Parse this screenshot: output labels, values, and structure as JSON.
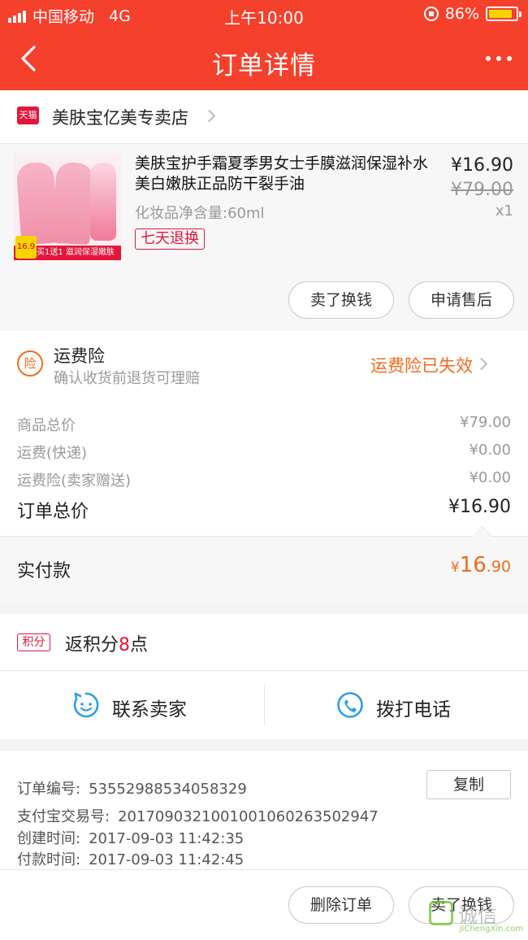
{
  "status_bar": {
    "carrier": "中国移动",
    "network": "4G",
    "time": "上午10:00",
    "battery": "86%",
    "battery_level": 0.86
  },
  "nav": {
    "title": "订单详情"
  },
  "store": {
    "badge": "天猫",
    "name": "美肤宝亿美专卖店"
  },
  "product": {
    "title": "美肤宝护手霜夏季男女士手膜滋润保湿补水美白嫩肤正品防干裂手油",
    "spec": "化妆品净含量:60ml",
    "tag": "七天退换",
    "price": "¥16.90",
    "original_price": "¥79.00",
    "quantity": "x1",
    "thumb_banner": "买1送1 滋润保湿嫩肤",
    "thumb_price": "16.9",
    "buttons": {
      "sell": "卖了换钱",
      "after_sale": "申请售后"
    }
  },
  "insurance": {
    "icon_text": "险",
    "title": "运费险",
    "subtitle": "确认收货前退货可理赔",
    "status": "运费险已失效"
  },
  "summary": {
    "rows": [
      {
        "label": "商品总价",
        "value": "¥79.00"
      },
      {
        "label": "运费(快递)",
        "value": "¥0.00"
      },
      {
        "label": "运费险(卖家赠送)",
        "value": "¥0.00"
      }
    ],
    "total_label": "订单总价",
    "total_value": "¥16.90"
  },
  "payment": {
    "label": "实付款",
    "symbol": "¥",
    "integer": "16",
    "decimal": ".90"
  },
  "points": {
    "badge": "积分",
    "prefix": "返积分",
    "count": "8",
    "suffix": "点"
  },
  "contact": {
    "seller": "联系卖家",
    "phone": "拨打电话"
  },
  "order_info": {
    "copy_label": "复制",
    "rows": [
      {
        "label": "订单编号:",
        "value": "53552988534058329"
      },
      {
        "label": "支付宝交易号:",
        "value": "2017090321001001060263502947"
      },
      {
        "label": "创建时间:",
        "value": "2017-09-03 11:42:35"
      },
      {
        "label": "付款时间:",
        "value": "2017-09-03 11:42:45"
      }
    ]
  },
  "footer": {
    "delete_order": "删除订单",
    "sell": "卖了换钱"
  },
  "watermark": {
    "text": "诚信",
    "sub": "JiChengXin.com"
  },
  "colors": {
    "brand_red": "#f5402c",
    "accent_orange": "#f06a1e",
    "tmall_red": "#e4163a"
  }
}
